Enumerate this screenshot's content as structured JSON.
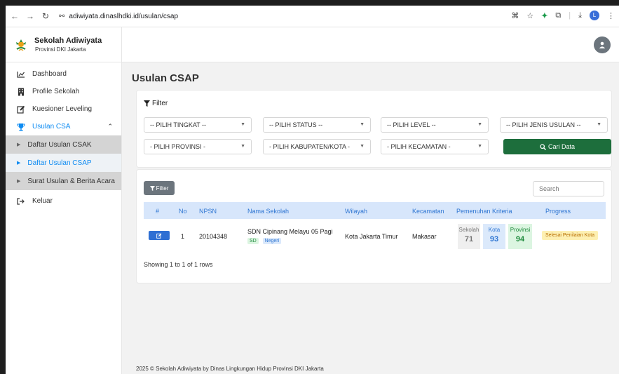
{
  "browser": {
    "url": "adiwiyata.dinaslhdki.id/usulan/csap",
    "profile_initial": "L"
  },
  "brand": {
    "title": "Sekolah Adiwiyata",
    "subtitle": "Provinsi DKI Jakarta"
  },
  "sidebar": {
    "items": [
      {
        "label": "Dashboard",
        "icon": "chart-line-icon"
      },
      {
        "label": "Profile Sekolah",
        "icon": "building-icon"
      },
      {
        "label": "Kuesioner Leveling",
        "icon": "edit-icon"
      },
      {
        "label": "Usulan CSA",
        "icon": "trophy-icon"
      }
    ],
    "submenu": [
      {
        "label": "Daftar Usulan CSAK"
      },
      {
        "label": "Daftar Usulan CSAP"
      },
      {
        "label": "Surat Usulan & Berita Acara"
      }
    ],
    "logout": {
      "label": "Keluar",
      "icon": "sign-out-icon"
    }
  },
  "page": {
    "title": "Usulan CSAP"
  },
  "filter": {
    "heading": "Filter",
    "selects": [
      {
        "value": "-- PILIH TINGKAT --"
      },
      {
        "value": "-- PILIH STATUS --"
      },
      {
        "value": "-- PILIH LEVEL --"
      },
      {
        "value": "-- PILIH JENIS USULAN --"
      },
      {
        "value": "- PILIH PROVINSI -"
      },
      {
        "value": "- PILIH KABUPATEN/KOTA -"
      },
      {
        "value": "- PILIH KECAMATAN -"
      }
    ],
    "search_button": "Cari Data"
  },
  "table": {
    "filter_button": "Filter",
    "search_placeholder": "Search",
    "headers": [
      "#",
      "No",
      "NPSN",
      "Nama Sekolah",
      "Wilayah",
      "Kecamatan",
      "Pemenuhan Kriteria",
      "Progress"
    ],
    "rows": [
      {
        "no": "1",
        "npsn": "20104348",
        "nama": "SDN Cipinang Melayu 05 Pagi",
        "jenjang": "SD",
        "status": "Negeri",
        "wilayah": "Kota Jakarta Timur",
        "kecamatan": "Makasar",
        "kriteria": [
          {
            "label": "Sekolah",
            "value": "71",
            "bg": "#efefef",
            "color": "#777777"
          },
          {
            "label": "Kota",
            "value": "93",
            "bg": "#dbe9fb",
            "color": "#2f76d2"
          },
          {
            "label": "Provinsi",
            "value": "94",
            "bg": "#dcf5e1",
            "color": "#1e8a3c"
          }
        ],
        "progress": "Selesai Penilaian Kota"
      }
    ],
    "showing": "Showing 1 to 1 of 1 rows"
  },
  "footer": {
    "text": "2025 © Sekolah Adiwiyata by Dinas Lingkungan Hidup Provinsi DKI Jakarta"
  },
  "colors": {
    "accent": "#0d8bf2",
    "header_bg": "#d7e6fb",
    "cari_button": "#1d6e3c",
    "edit_button": "#2f6fd3",
    "progress_badge": "#fdf0b3"
  }
}
